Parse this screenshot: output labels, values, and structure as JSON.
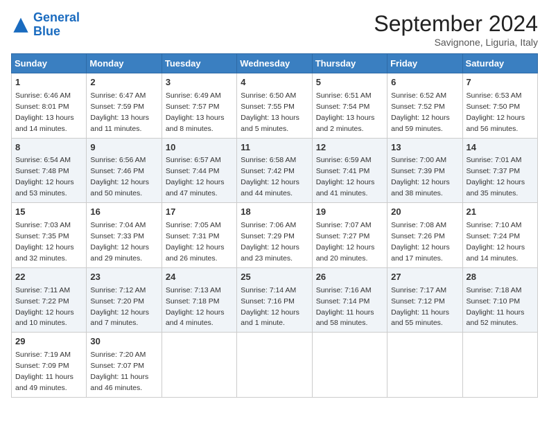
{
  "header": {
    "logo_line1": "General",
    "logo_line2": "Blue",
    "month_year": "September 2024",
    "location": "Savignone, Liguria, Italy"
  },
  "days_of_week": [
    "Sunday",
    "Monday",
    "Tuesday",
    "Wednesday",
    "Thursday",
    "Friday",
    "Saturday"
  ],
  "weeks": [
    [
      {
        "day": "1",
        "sunrise": "6:46 AM",
        "sunset": "8:01 PM",
        "daylight": "13 hours and 14 minutes."
      },
      {
        "day": "2",
        "sunrise": "6:47 AM",
        "sunset": "7:59 PM",
        "daylight": "13 hours and 11 minutes."
      },
      {
        "day": "3",
        "sunrise": "6:49 AM",
        "sunset": "7:57 PM",
        "daylight": "13 hours and 8 minutes."
      },
      {
        "day": "4",
        "sunrise": "6:50 AM",
        "sunset": "7:55 PM",
        "daylight": "13 hours and 5 minutes."
      },
      {
        "day": "5",
        "sunrise": "6:51 AM",
        "sunset": "7:54 PM",
        "daylight": "13 hours and 2 minutes."
      },
      {
        "day": "6",
        "sunrise": "6:52 AM",
        "sunset": "7:52 PM",
        "daylight": "12 hours and 59 minutes."
      },
      {
        "day": "7",
        "sunrise": "6:53 AM",
        "sunset": "7:50 PM",
        "daylight": "12 hours and 56 minutes."
      }
    ],
    [
      {
        "day": "8",
        "sunrise": "6:54 AM",
        "sunset": "7:48 PM",
        "daylight": "12 hours and 53 minutes."
      },
      {
        "day": "9",
        "sunrise": "6:56 AM",
        "sunset": "7:46 PM",
        "daylight": "12 hours and 50 minutes."
      },
      {
        "day": "10",
        "sunrise": "6:57 AM",
        "sunset": "7:44 PM",
        "daylight": "12 hours and 47 minutes."
      },
      {
        "day": "11",
        "sunrise": "6:58 AM",
        "sunset": "7:42 PM",
        "daylight": "12 hours and 44 minutes."
      },
      {
        "day": "12",
        "sunrise": "6:59 AM",
        "sunset": "7:41 PM",
        "daylight": "12 hours and 41 minutes."
      },
      {
        "day": "13",
        "sunrise": "7:00 AM",
        "sunset": "7:39 PM",
        "daylight": "12 hours and 38 minutes."
      },
      {
        "day": "14",
        "sunrise": "7:01 AM",
        "sunset": "7:37 PM",
        "daylight": "12 hours and 35 minutes."
      }
    ],
    [
      {
        "day": "15",
        "sunrise": "7:03 AM",
        "sunset": "7:35 PM",
        "daylight": "12 hours and 32 minutes."
      },
      {
        "day": "16",
        "sunrise": "7:04 AM",
        "sunset": "7:33 PM",
        "daylight": "12 hours and 29 minutes."
      },
      {
        "day": "17",
        "sunrise": "7:05 AM",
        "sunset": "7:31 PM",
        "daylight": "12 hours and 26 minutes."
      },
      {
        "day": "18",
        "sunrise": "7:06 AM",
        "sunset": "7:29 PM",
        "daylight": "12 hours and 23 minutes."
      },
      {
        "day": "19",
        "sunrise": "7:07 AM",
        "sunset": "7:27 PM",
        "daylight": "12 hours and 20 minutes."
      },
      {
        "day": "20",
        "sunrise": "7:08 AM",
        "sunset": "7:26 PM",
        "daylight": "12 hours and 17 minutes."
      },
      {
        "day": "21",
        "sunrise": "7:10 AM",
        "sunset": "7:24 PM",
        "daylight": "12 hours and 14 minutes."
      }
    ],
    [
      {
        "day": "22",
        "sunrise": "7:11 AM",
        "sunset": "7:22 PM",
        "daylight": "12 hours and 10 minutes."
      },
      {
        "day": "23",
        "sunrise": "7:12 AM",
        "sunset": "7:20 PM",
        "daylight": "12 hours and 7 minutes."
      },
      {
        "day": "24",
        "sunrise": "7:13 AM",
        "sunset": "7:18 PM",
        "daylight": "12 hours and 4 minutes."
      },
      {
        "day": "25",
        "sunrise": "7:14 AM",
        "sunset": "7:16 PM",
        "daylight": "12 hours and 1 minute."
      },
      {
        "day": "26",
        "sunrise": "7:16 AM",
        "sunset": "7:14 PM",
        "daylight": "11 hours and 58 minutes."
      },
      {
        "day": "27",
        "sunrise": "7:17 AM",
        "sunset": "7:12 PM",
        "daylight": "11 hours and 55 minutes."
      },
      {
        "day": "28",
        "sunrise": "7:18 AM",
        "sunset": "7:10 PM",
        "daylight": "11 hours and 52 minutes."
      }
    ],
    [
      {
        "day": "29",
        "sunrise": "7:19 AM",
        "sunset": "7:09 PM",
        "daylight": "11 hours and 49 minutes."
      },
      {
        "day": "30",
        "sunrise": "7:20 AM",
        "sunset": "7:07 PM",
        "daylight": "11 hours and 46 minutes."
      },
      null,
      null,
      null,
      null,
      null
    ]
  ]
}
